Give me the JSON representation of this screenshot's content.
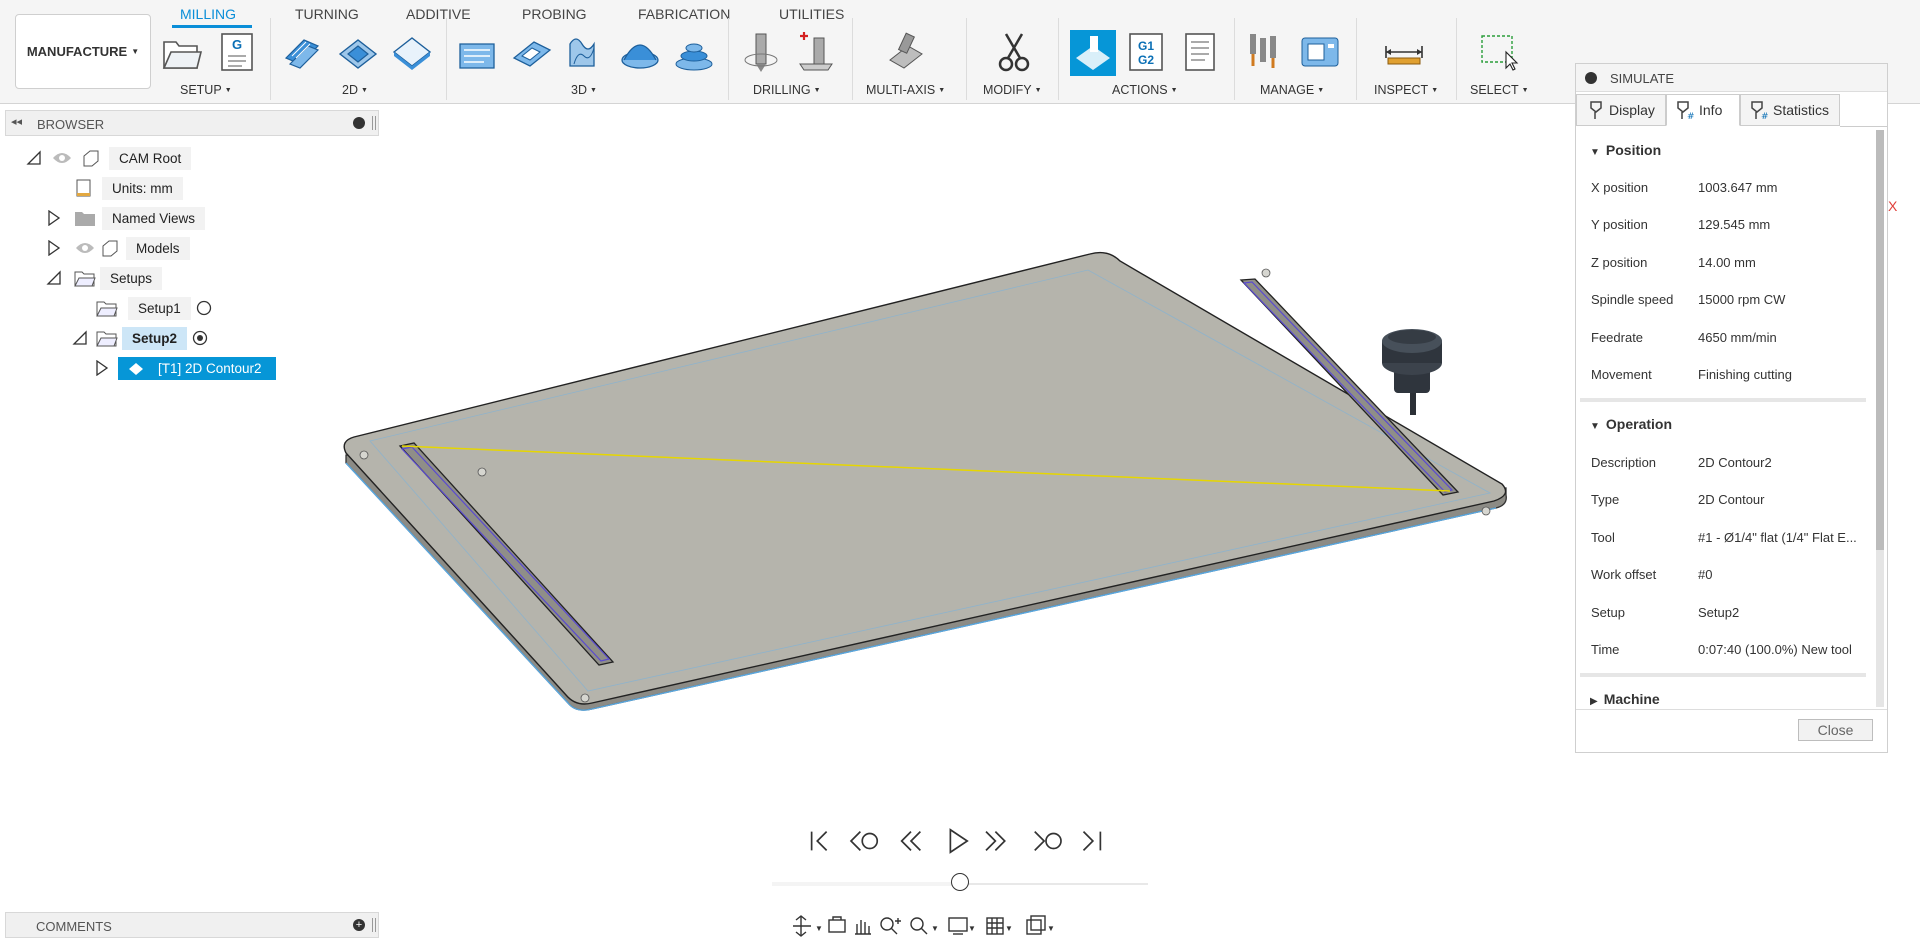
{
  "ribbon": {
    "workspace": "MANUFACTURE",
    "tabs": [
      {
        "label": "MILLING",
        "active": true
      },
      {
        "label": "TURNING"
      },
      {
        "label": "ADDITIVE"
      },
      {
        "label": "PROBING"
      },
      {
        "label": "FABRICATION"
      },
      {
        "label": "UTILITIES"
      }
    ],
    "groups": [
      "SETUP",
      "2D",
      "3D",
      "DRILLING",
      "MULTI-AXIS",
      "MODIFY",
      "ACTIONS",
      "MANAGE",
      "INSPECT",
      "SELECT"
    ],
    "nc_program_icon_letter": "G",
    "post_icon_text": [
      "G1",
      "G2"
    ]
  },
  "browser": {
    "title": "BROWSER",
    "items": [
      {
        "label": "CAM Root"
      },
      {
        "label": "Units: mm"
      },
      {
        "label": "Named Views"
      },
      {
        "label": "Models"
      },
      {
        "label": "Setups"
      },
      {
        "label": "Setup1"
      },
      {
        "label": "Setup2"
      },
      {
        "label": "[T1] 2D Contour2"
      }
    ]
  },
  "simulate": {
    "title": "SIMULATE",
    "tabs": [
      "Display",
      "Info",
      "Statistics"
    ],
    "active_tab": "Info",
    "position": {
      "heading": "Position",
      "rows": [
        {
          "k": "X position",
          "v": "1003.647 mm"
        },
        {
          "k": "Y position",
          "v": "129.545 mm"
        },
        {
          "k": "Z position",
          "v": "14.00 mm"
        },
        {
          "k": "Spindle speed",
          "v": "15000 rpm CW"
        },
        {
          "k": "Feedrate",
          "v": "4650 mm/min"
        },
        {
          "k": "Movement",
          "v": "Finishing cutting"
        }
      ]
    },
    "operation": {
      "heading": "Operation",
      "rows": [
        {
          "k": "Description",
          "v": "2D Contour2"
        },
        {
          "k": "Type",
          "v": "2D Contour"
        },
        {
          "k": "Tool",
          "v": "#1 - Ø1/4\" flat (1/4\" Flat E..."
        },
        {
          "k": "Work offset",
          "v": "#0"
        },
        {
          "k": "Setup",
          "v": "Setup2"
        },
        {
          "k": "Time",
          "v": "0:07:40 (100.0%) New tool"
        }
      ]
    },
    "machine": {
      "heading": "Machine"
    },
    "close_label": "Close",
    "axis_label": "X"
  },
  "playback": {
    "progress": 0.5
  },
  "comments": {
    "title": "COMMENTS"
  },
  "colors": {
    "accent": "#0696d7",
    "plate": "#b5b4ac",
    "toolpath": "#e6d600"
  }
}
